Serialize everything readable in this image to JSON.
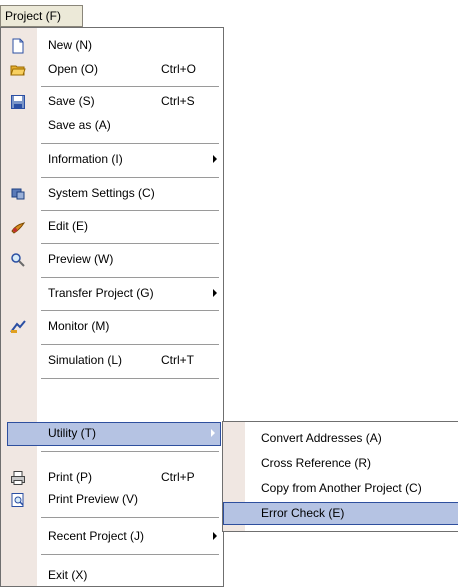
{
  "menubar": {
    "label": "Project (F)"
  },
  "menu": {
    "items": [
      {
        "label": "New (N)",
        "shortcut": "",
        "icon": "new-file-icon"
      },
      {
        "label": "Open (O)",
        "shortcut": "Ctrl+O",
        "icon": "open-folder-icon"
      },
      {
        "label": "Save (S)",
        "shortcut": "Ctrl+S",
        "icon": "save-icon"
      },
      {
        "label": "Save as (A)",
        "shortcut": ""
      },
      {
        "label": "Information (I)",
        "shortcut": ""
      },
      {
        "label": "System Settings (C)",
        "shortcut": "",
        "icon": "system-settings-icon"
      },
      {
        "label": "Edit (E)",
        "shortcut": "",
        "icon": "edit-icon"
      },
      {
        "label": "Preview (W)",
        "shortcut": "",
        "icon": "preview-icon"
      },
      {
        "label": "Transfer Project (G)",
        "shortcut": ""
      },
      {
        "label": "Monitor (M)",
        "shortcut": "",
        "icon": "monitor-icon"
      },
      {
        "label": "Simulation (L)",
        "shortcut": "Ctrl+T"
      },
      {
        "label": "Utility (T)",
        "shortcut": ""
      },
      {
        "label": "Print (P)",
        "shortcut": "Ctrl+P",
        "icon": "print-icon"
      },
      {
        "label": "Print Preview (V)",
        "shortcut": "",
        "icon": "print-preview-icon"
      },
      {
        "label": "Recent Project (J)",
        "shortcut": ""
      },
      {
        "label": "Exit (X)",
        "shortcut": ""
      }
    ]
  },
  "submenu": {
    "items": [
      {
        "label": "Convert Addresses (A)"
      },
      {
        "label": "Cross Reference (R)"
      },
      {
        "label": "Copy from Another Project (C)"
      },
      {
        "label": "Error Check (E)"
      }
    ]
  },
  "colors": {
    "highlight": "#b5c3e3",
    "highlight_border": "#2e4f9e",
    "gutter": "#f0e7e2",
    "menubar": "#ece9d8"
  }
}
